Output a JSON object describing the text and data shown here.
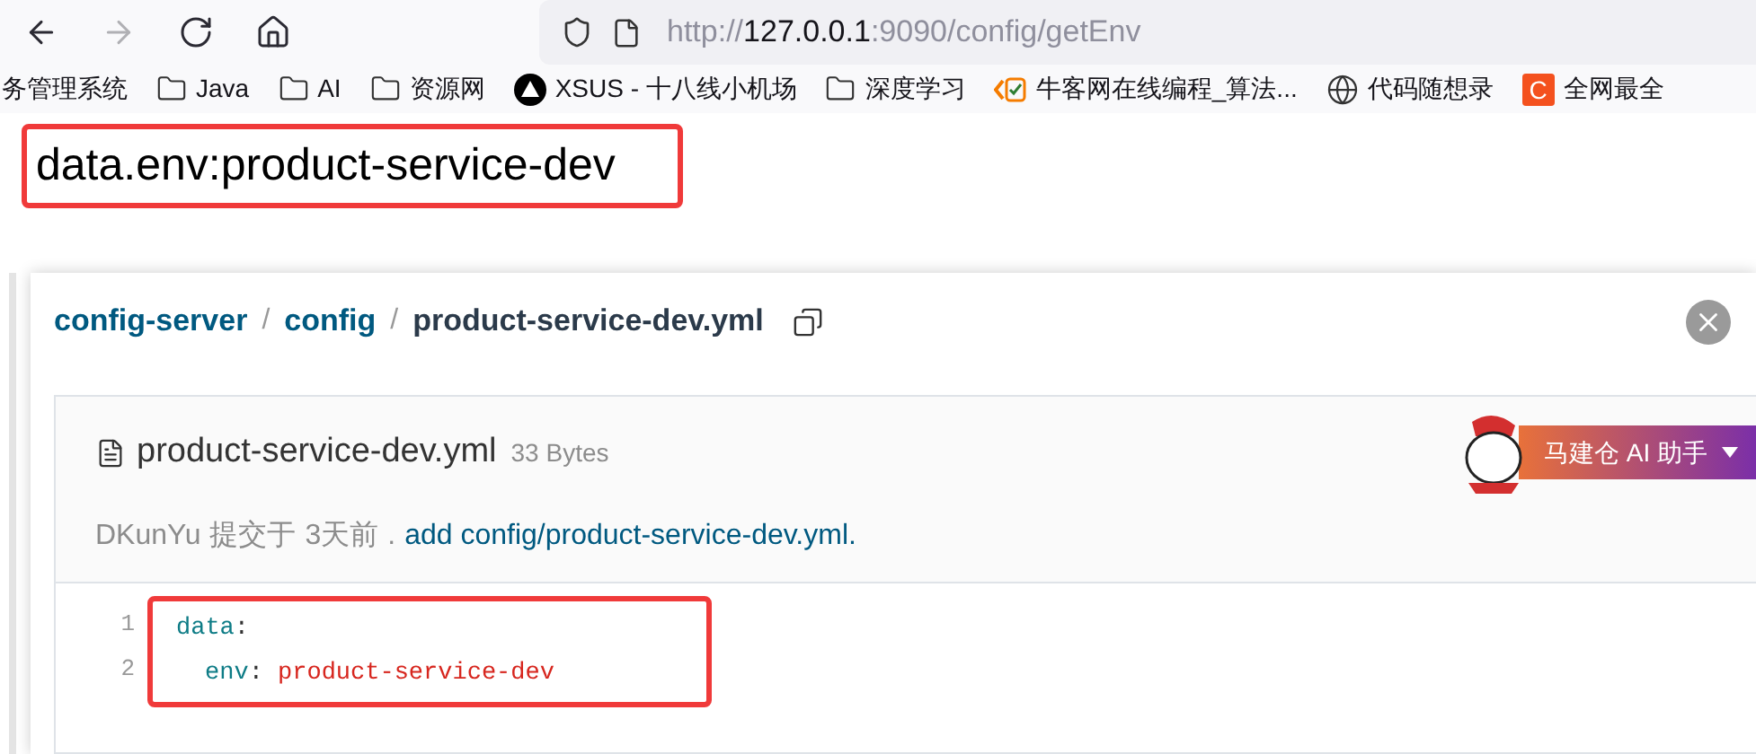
{
  "toolbar": {
    "buttons": [
      {
        "kind": "back",
        "disabled": false
      },
      {
        "kind": "forward",
        "disabled": true
      },
      {
        "kind": "reload",
        "disabled": false
      },
      {
        "kind": "home",
        "disabled": false
      }
    ],
    "url_parts": [
      {
        "text": "http://",
        "emphasis": false
      },
      {
        "text": "127.0.0.1",
        "emphasis": true
      },
      {
        "text": ":9090/config/getEnv",
        "emphasis": false
      }
    ]
  },
  "bookmarks": [
    {
      "kind": "none",
      "label": "务管理系统"
    },
    {
      "kind": "folder",
      "label": "Java"
    },
    {
      "kind": "folder",
      "label": "AI"
    },
    {
      "kind": "folder",
      "label": "资源网"
    },
    {
      "kind": "triangle",
      "label": "XSUS - 十八线小机场"
    },
    {
      "kind": "folder",
      "label": "深度学习"
    },
    {
      "kind": "code",
      "label": "牛客网在线编程_算法..."
    },
    {
      "kind": "globe",
      "label": "代码随想录"
    },
    {
      "kind": "letter",
      "label": "全网最全",
      "glyph": "C"
    }
  ],
  "response": {
    "text": "data.env:product-service-dev"
  },
  "file_view": {
    "breadcrumb": [
      {
        "label": "config-server",
        "current": false
      },
      {
        "label": "config",
        "current": false
      },
      {
        "label": "product-service-dev.yml",
        "current": true
      }
    ],
    "separator": "/",
    "file_name": "product-service-dev.yml",
    "size": "33 Bytes",
    "assistant": {
      "label": "马建仓 AI 助手"
    },
    "commit": {
      "author": "DKunYu",
      "verb": "提交于",
      "time": "3天前",
      "dot": ".",
      "message": "add config/product-service-dev.yml."
    },
    "code_lines": [
      {
        "number": "1",
        "indent": false,
        "key": "data",
        "colon": ":"
      },
      {
        "number": "2",
        "indent": true,
        "key": "env",
        "colon": ":",
        "value": "product-service-dev"
      }
    ]
  }
}
